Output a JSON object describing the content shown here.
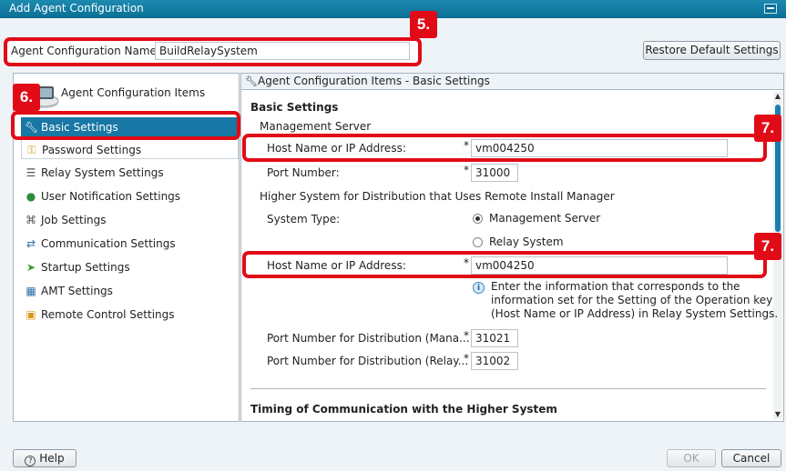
{
  "window": {
    "title": "Add Agent Configuration"
  },
  "agent_name": {
    "label": "Agent Configuration Name:",
    "required_mark": "*",
    "value": "BuildRelaySystem"
  },
  "restore_default_label": "Restore Default Settings",
  "left_panel": {
    "header": "Agent Configuration Items",
    "items": [
      {
        "label": "Basic Settings",
        "icon": "wrench-icon"
      },
      {
        "label": "Password Settings",
        "icon": "key-icon"
      },
      {
        "label": "Relay System Settings",
        "icon": "network-icon"
      },
      {
        "label": "User Notification Settings",
        "icon": "users-icon"
      },
      {
        "label": "Job Settings",
        "icon": "job-icon"
      },
      {
        "label": "Communication Settings",
        "icon": "communication-icon"
      },
      {
        "label": "Startup Settings",
        "icon": "startup-icon"
      },
      {
        "label": "AMT Settings",
        "icon": "amt-icon"
      },
      {
        "label": "Remote Control Settings",
        "icon": "remote-control-icon"
      }
    ]
  },
  "right_panel": {
    "header": "Agent Configuration Items - Basic Settings",
    "section_title": "Basic Settings",
    "management_server": "Management Server",
    "host_label": "Host Name or IP Address:",
    "host_value": "vm004250",
    "port_label": "Port Number:",
    "port_value": "31000",
    "higher_system": "Higher System for Distribution that Uses Remote Install Manager",
    "system_type_label": "System Type:",
    "radio_management": "Management Server",
    "radio_relay": "Relay System",
    "host2_label": "Host Name or IP Address:",
    "host2_value": "vm004250",
    "info_line1": "Enter the information that corresponds to the",
    "info_line2": "information set for the Setting of the Operation key",
    "info_line3": "(Host Name or IP Address) in Relay System Settings.",
    "port_dist_mana_label": "Port Number for Distribution (Mana...",
    "port_dist_mana_value": "31021",
    "port_dist_relay_label": "Port Number for Distribution (Relay...",
    "port_dist_relay_value": "31002",
    "timing_title": "Timing of Communication with the Higher System",
    "required_mark": "*"
  },
  "callouts": {
    "c5": "5.",
    "c6": "6.",
    "c7a": "7.",
    "c7b": "7."
  },
  "footer": {
    "help": "Help",
    "ok": "OK",
    "cancel": "Cancel"
  },
  "colors": {
    "callout": "#e10b17",
    "selected": "#1877a4",
    "titlebar": "#0a6f96"
  }
}
